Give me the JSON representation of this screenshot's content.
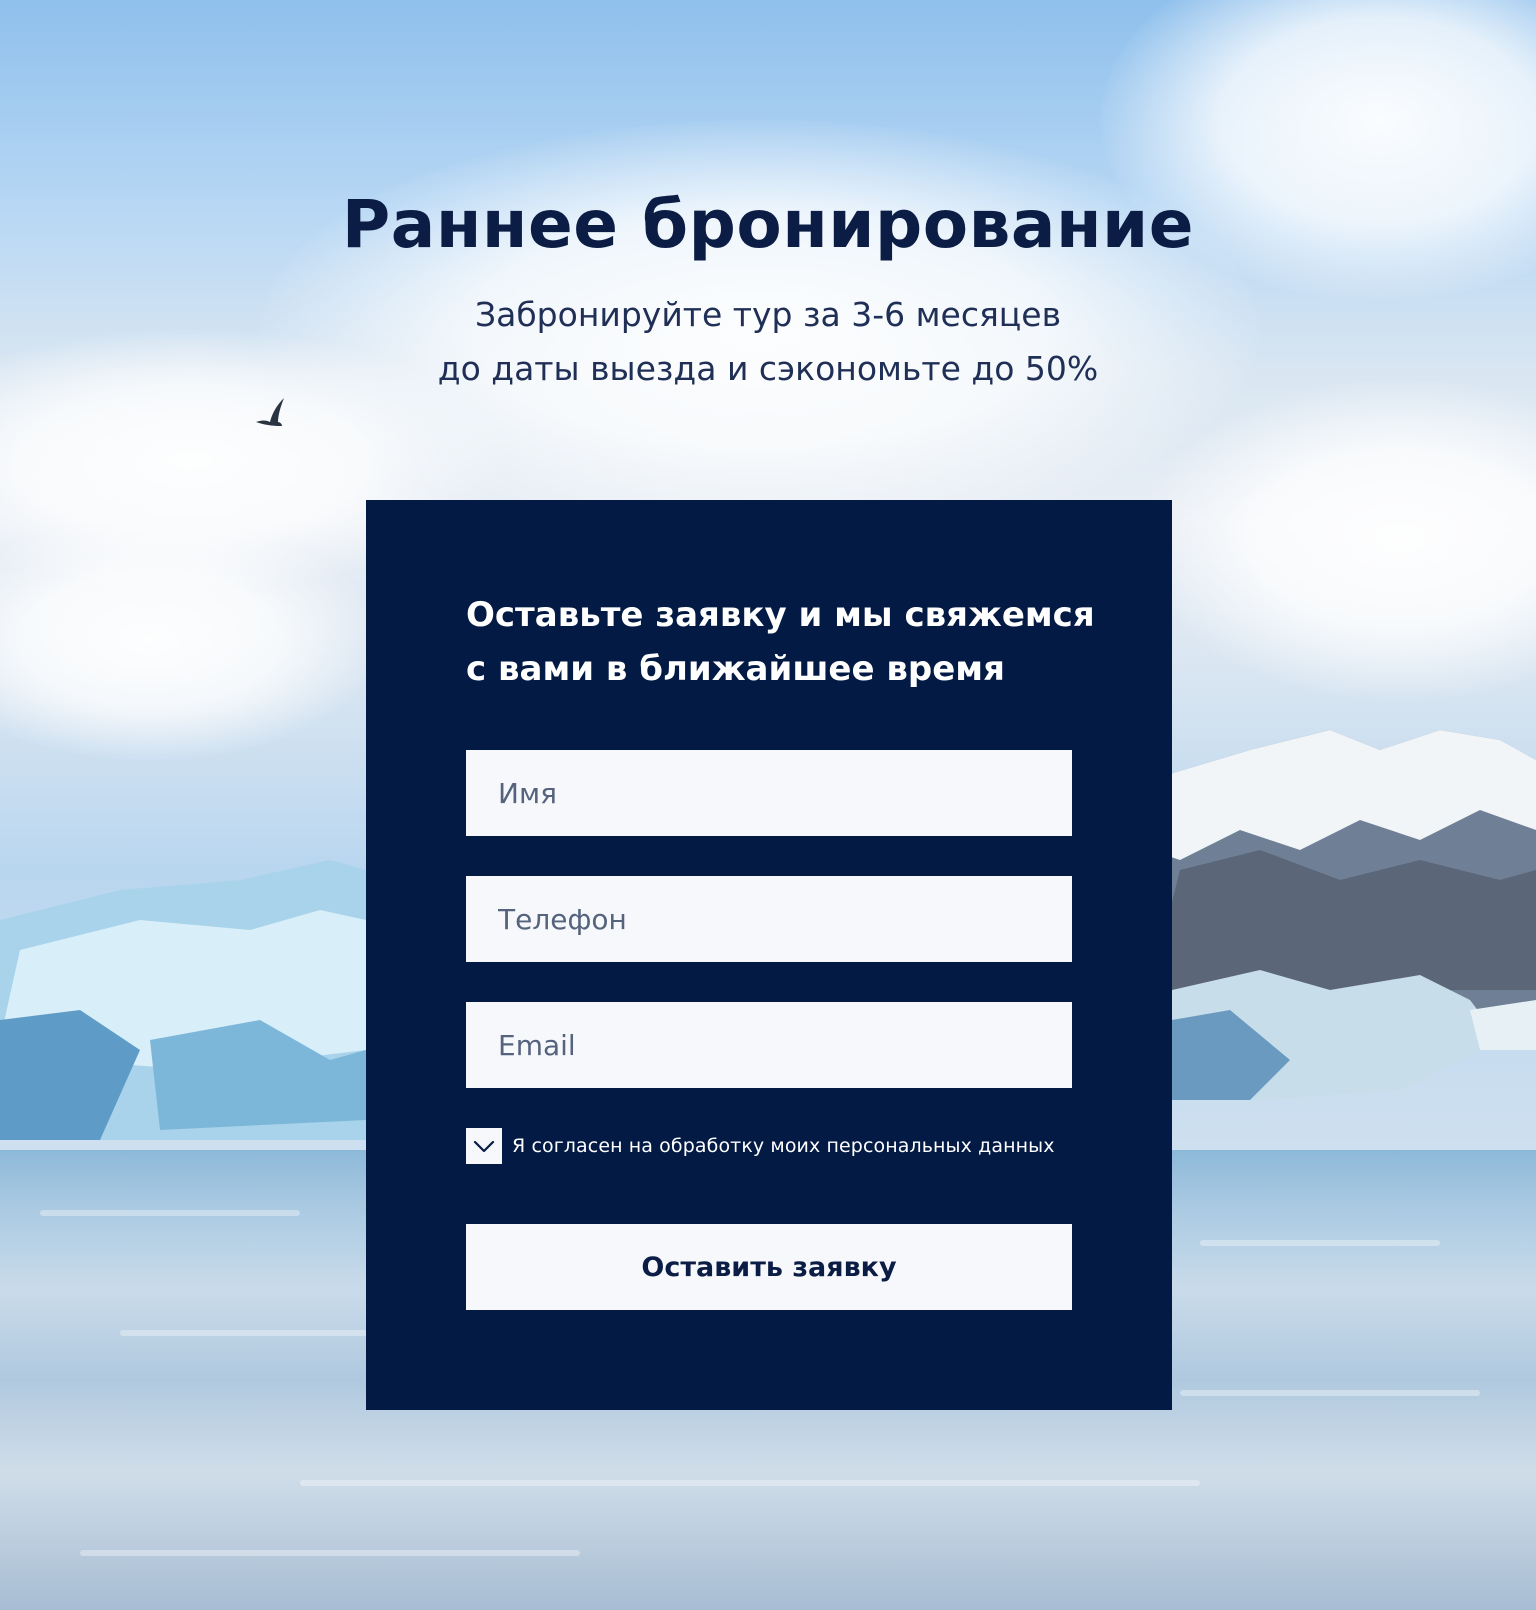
{
  "hero": {
    "title": "Раннее бронирование",
    "subtitle_line1": "Забронируйте тур за 3-6 месяцев",
    "subtitle_line2": "до даты выезда и сэкономьте до 50%"
  },
  "form": {
    "heading_line1": "Оставьте заявку и мы свяжемся",
    "heading_line2": "с вами в ближайшее время",
    "name_field": {
      "placeholder": "Имя",
      "value": ""
    },
    "phone_field": {
      "placeholder": "Телефон",
      "value": ""
    },
    "email_field": {
      "placeholder": "Email",
      "value": ""
    },
    "consent": {
      "label": "Я согласен на обработку моих персональных данных",
      "checked": true
    },
    "submit_label": "Оставить заявку"
  },
  "icons": {
    "checkmark": "check-icon",
    "bird": "bird-icon"
  },
  "colors": {
    "card_background": "#031a44",
    "heading_text": "#0b1d45",
    "field_background": "#f6f8fc",
    "placeholder_text": "#56637d"
  }
}
